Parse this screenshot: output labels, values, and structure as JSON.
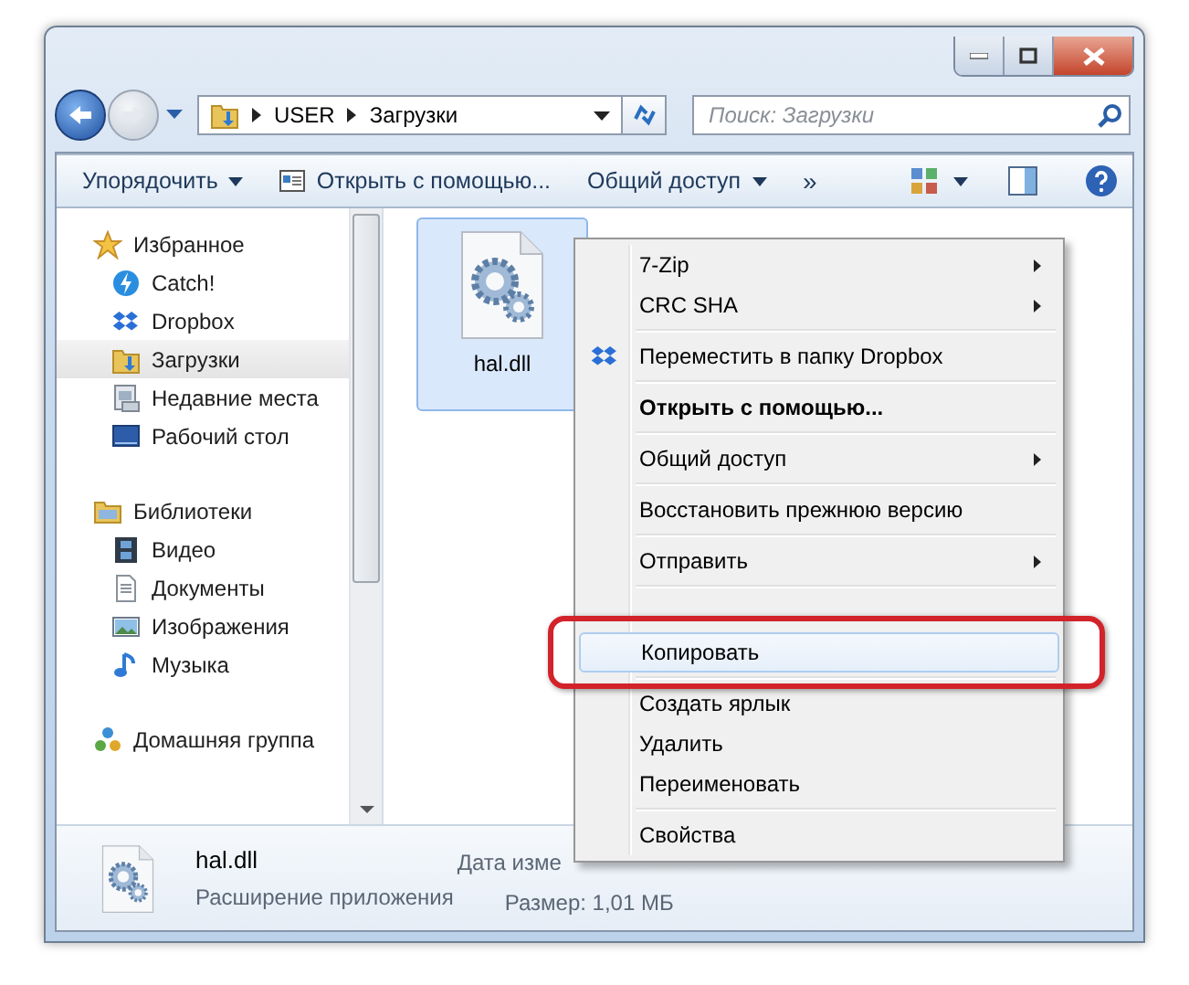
{
  "address_bar": {
    "path": [
      "USER",
      "Загрузки"
    ]
  },
  "search": {
    "placeholder": "Поиск: Загрузки"
  },
  "toolbar": {
    "items": [
      {
        "label": "Упорядочить",
        "kind": "dropdown"
      },
      {
        "label": "Открыть с помощью...",
        "kind": "open"
      },
      {
        "label": "Общий доступ",
        "kind": "dropdown"
      },
      {
        "label": "»",
        "kind": "more"
      }
    ]
  },
  "nav": {
    "items": [
      {
        "label": "Избранное",
        "kind": "star",
        "selected": false,
        "children": [
          {
            "label": "Catch!",
            "kind": "catch",
            "selected": false
          },
          {
            "label": "Dropbox",
            "kind": "dropbox",
            "selected": false
          },
          {
            "label": "Загрузки",
            "kind": "downloads",
            "selected": true
          },
          {
            "label": "Недавние места",
            "kind": "recent",
            "selected": false
          },
          {
            "label": "Рабочий стол",
            "kind": "desktop",
            "selected": false
          }
        ]
      },
      {
        "label": "Библиотеки",
        "kind": "library",
        "selected": false,
        "children": [
          {
            "label": "Видео",
            "kind": "video",
            "selected": false
          },
          {
            "label": "Документы",
            "kind": "document",
            "selected": false
          },
          {
            "label": "Изображения",
            "kind": "image",
            "selected": false
          },
          {
            "label": "Музыка",
            "kind": "music",
            "selected": false
          }
        ]
      },
      {
        "label": "Домашняя группа",
        "kind": "homegroup",
        "selected": false
      }
    ]
  },
  "files": [
    {
      "name": "hal.dll",
      "selected": true
    }
  ],
  "context_menu": {
    "groups": [
      [
        {
          "label": "7-Zip",
          "submenu": true,
          "bold": false,
          "selected": false
        },
        {
          "label": "CRC SHA",
          "submenu": true,
          "bold": false,
          "selected": false
        }
      ],
      [
        {
          "label": "Переместить в папку Dropbox",
          "submenu": false,
          "bold": false,
          "selected": false,
          "kind": "dropbox"
        }
      ],
      [
        {
          "label": "Открыть с помощью...",
          "submenu": false,
          "bold": true,
          "selected": false
        }
      ],
      [
        {
          "label": "Общий доступ",
          "submenu": true,
          "bold": false,
          "selected": false
        }
      ],
      [
        {
          "label": "Восстановить прежнюю версию",
          "submenu": false,
          "bold": false,
          "selected": false
        }
      ],
      [
        {
          "label": "Отправить",
          "submenu": true,
          "bold": false,
          "selected": false
        }
      ],
      [
        {
          "kind": "obscured"
        },
        {
          "label": "Копировать",
          "submenu": false,
          "bold": false,
          "selected": true
        }
      ],
      [
        {
          "label": "Создать ярлык",
          "submenu": false,
          "bold": false,
          "selected": false
        },
        {
          "label": "Удалить",
          "submenu": false,
          "bold": false,
          "selected": false
        },
        {
          "label": "Переименовать",
          "submenu": false,
          "bold": false,
          "selected": false
        }
      ],
      [
        {
          "label": "Свойства",
          "submenu": false,
          "bold": false,
          "selected": false
        }
      ]
    ]
  },
  "details": {
    "name": "hal.dll",
    "type": "Расширение приложения",
    "date_label": "Дата изме",
    "size": "Размер: 1,01 МБ"
  }
}
